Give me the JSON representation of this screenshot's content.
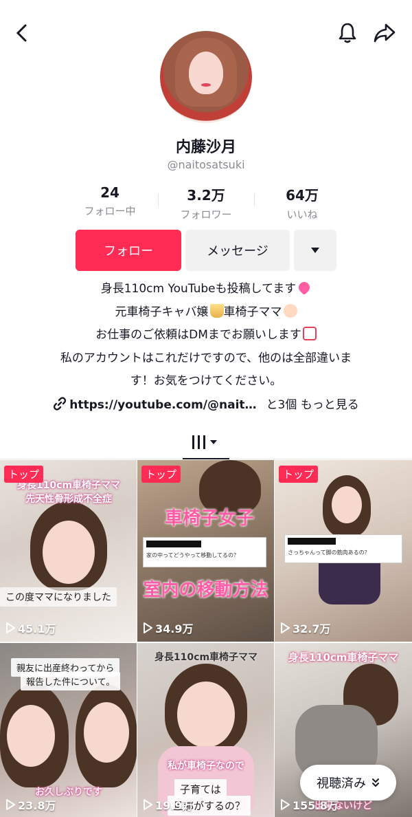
{
  "profile": {
    "name": "内藤沙月",
    "handle": "@naitosatsuki"
  },
  "stats": [
    {
      "value": "24",
      "label": "フォロー中"
    },
    {
      "value": "3.2万",
      "label": "フォロワー"
    },
    {
      "value": "64万",
      "label": "いいね"
    }
  ],
  "actions": {
    "follow": "フォロー",
    "message": "メッセージ"
  },
  "bio": {
    "line1": "身長110cm YouTubeも投稿してます",
    "line2a": "元車椅子キャバ嬢",
    "line2b": "車椅子ママ",
    "line3": "お仕事のご依頼はDMまでお願いします",
    "line4": "私のアカウントはこれだけですので、他のは全部違いま",
    "line5": "す！お気をつけてください。"
  },
  "link": {
    "url": "https://youtube.com/@nait…",
    "more": "と3個 もっと見る"
  },
  "videos": [
    {
      "badge": "トップ",
      "views": "45.1万",
      "overlay_top": "身長110cm車椅子ママ",
      "overlay_top2": "先天性骨形成不全症",
      "overlay_bottom": "この度ママになりました"
    },
    {
      "badge": "トップ",
      "views": "34.9万",
      "overlay_mid": "車椅子女子",
      "comment": "家の中ってどうやって移動してるの？",
      "overlay_bottom": "室内の移動方法"
    },
    {
      "badge": "トップ",
      "views": "32.7万",
      "comment": "さっちゃんって脚の筋肉あるの？"
    },
    {
      "views": "23.8万",
      "overlay_top": "親友に出産終わってから",
      "overlay_top2": "報告した件について。",
      "overlay_bottom": "お久しぶりです"
    },
    {
      "views": "19.9万",
      "overlay_top": "身長110cm車椅子ママ",
      "overlay_mid": "私が車椅子なので",
      "overlay_bottom": "子育ては",
      "overlay_bottom2": "旦那がするの？"
    },
    {
      "views": "155.8万",
      "overlay_top": "身長110cm車椅子ママ",
      "overlay_bottom": "出来ないけど"
    }
  ],
  "watched_label": "視聴済み",
  "colors": {
    "accent": "#fe2c55"
  }
}
